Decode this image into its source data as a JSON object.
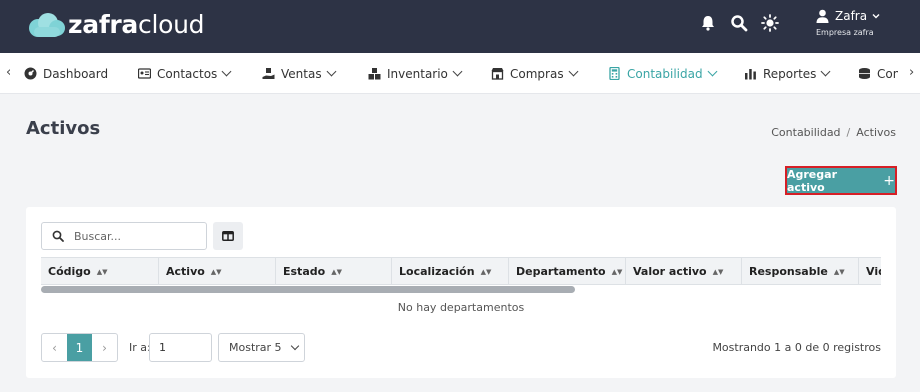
{
  "brand": {
    "prefix": "zafra",
    "suffix": "cloud"
  },
  "user": {
    "name": "Zafra",
    "company": "Empresa zafra"
  },
  "header_icons": [
    "bell-icon",
    "search-icon",
    "sun-icon",
    "user-icon"
  ],
  "nav": {
    "items": [
      {
        "label": "Dashboard",
        "icon": "dashboard-icon",
        "has_caret": false
      },
      {
        "label": "Contactos",
        "icon": "contacts-card-icon",
        "has_caret": true
      },
      {
        "label": "Ventas",
        "icon": "sales-hand-icon",
        "has_caret": true
      },
      {
        "label": "Inventario",
        "icon": "boxes-icon",
        "has_caret": true
      },
      {
        "label": "Compras",
        "icon": "store-icon",
        "has_caret": true
      },
      {
        "label": "Contabilidad",
        "icon": "calculator-icon",
        "has_caret": true,
        "active": true
      },
      {
        "label": "Reportes",
        "icon": "bar-chart-icon",
        "has_caret": true
      },
      {
        "label": "Con",
        "icon": "coins-icon",
        "has_caret": false
      }
    ]
  },
  "page": {
    "title": "Activos",
    "breadcrumb": {
      "parent": "Contabilidad",
      "separator": "/",
      "current": "Activos"
    },
    "add_button": "Agregar activo",
    "add_button_plus": "+"
  },
  "table": {
    "search_placeholder": "Buscar...",
    "columns": [
      "Código",
      "Activo",
      "Estado",
      "Localización",
      "Departamento",
      "Valor activo",
      "Responsable",
      "Vid"
    ],
    "empty_message": "No hay departamentos"
  },
  "pagination": {
    "current_page": "1",
    "prev": "‹",
    "next": "›",
    "goto_label": "Ir a:",
    "goto_value": "1",
    "page_size_label": "Mostrar 5",
    "summary": "Mostrando 1 a 0 de 0 registros"
  },
  "colors": {
    "header_bg": "#2d3345",
    "accent": "#4a9fa3",
    "highlight_border": "#d61f26"
  }
}
